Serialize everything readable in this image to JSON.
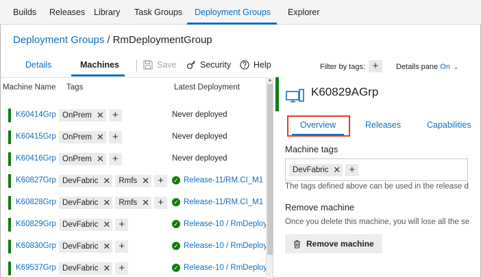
{
  "nav": {
    "items": [
      {
        "label": "Builds"
      },
      {
        "label": "Releases"
      },
      {
        "label": "Library"
      },
      {
        "label": "Task Groups"
      },
      {
        "label": "Deployment Groups"
      },
      {
        "label": "Explorer"
      }
    ],
    "active_index": 4
  },
  "breadcrumb": {
    "parent": "Deployment Groups",
    "separator": "/",
    "current": "RmDeploymentGroup"
  },
  "subtabs": {
    "details": "Details",
    "machines": "Machines",
    "active": "Machines"
  },
  "toolbar": {
    "save_label": "Save",
    "security_label": "Security",
    "help_label": "Help",
    "filter_label": "Filter by tags:",
    "details_pane_label": "Details pane",
    "details_pane_value": "On"
  },
  "grid": {
    "headers": {
      "machine": "Machine Name",
      "tags": "Tags",
      "deployment": "Latest Deployment"
    },
    "rows": [
      {
        "name": "K60414Grp",
        "tags": [
          "OnPrem"
        ],
        "deployment": "Never deployed",
        "deployed": false
      },
      {
        "name": "K60415Grp",
        "tags": [
          "OnPrem"
        ],
        "deployment": "Never deployed",
        "deployed": false
      },
      {
        "name": "K60416Grp",
        "tags": [
          "OnPrem"
        ],
        "deployment": "Never deployed",
        "deployed": false
      },
      {
        "name": "K60827Grp",
        "tags": [
          "DevFabric",
          "Rmfs"
        ],
        "deployment": "Release-11/RM.CI_M1",
        "deployed": true
      },
      {
        "name": "K60828Grp",
        "tags": [
          "DevFabric",
          "Rmfs"
        ],
        "deployment": "Release-11/RM.CI_M1",
        "deployed": true
      },
      {
        "name": "K60829Grp",
        "tags": [
          "DevFabric"
        ],
        "deployment": "Release-10 / RmDeploy",
        "deployed": true
      },
      {
        "name": "K60830Grp",
        "tags": [
          "DevFabric"
        ],
        "deployment": "Release-10 / RmDeploy",
        "deployed": true
      },
      {
        "name": "K69537Grp",
        "tags": [
          "DevFabric"
        ],
        "deployment": "Release-10 / RmDeploy",
        "deployed": true
      }
    ]
  },
  "details_pane": {
    "title": "K60829AGrp",
    "tabs": [
      {
        "label": "Overview"
      },
      {
        "label": "Releases"
      },
      {
        "label": "Capabilities"
      }
    ],
    "active_tab": "Overview",
    "machine_tags_label": "Machine tags",
    "machine_tags": [
      "DevFabric"
    ],
    "tags_helper": "The tags defined above can be used in the release d",
    "remove_label": "Remove machine",
    "remove_helper": "Once you delete this machine, you will lose all the se",
    "remove_button": "Remove machine"
  },
  "colors": {
    "accent": "#106ebe",
    "online": "#107c10",
    "highlight": "#e03c31"
  }
}
